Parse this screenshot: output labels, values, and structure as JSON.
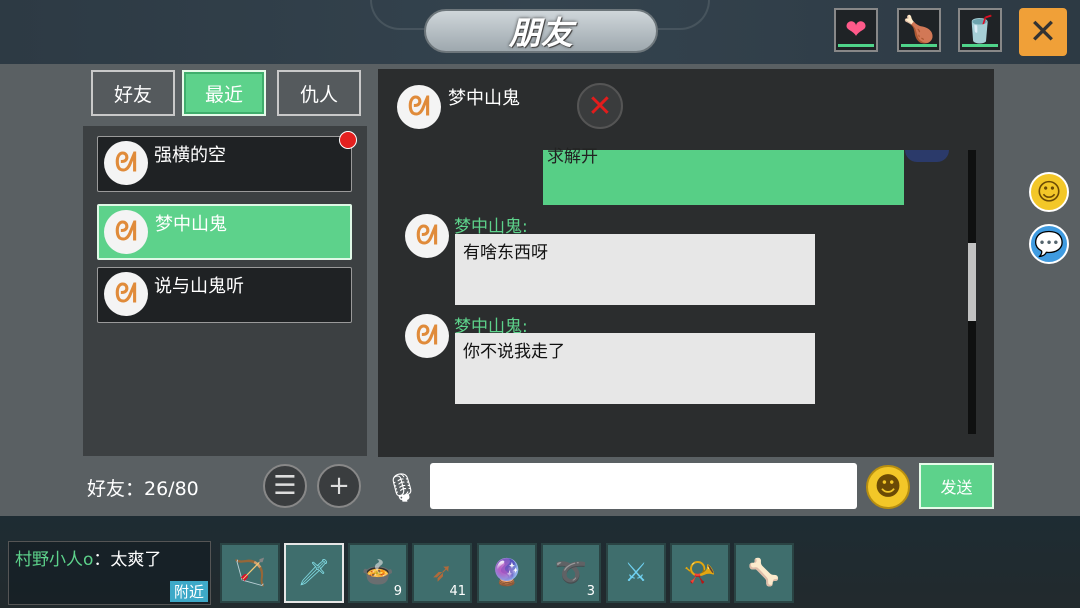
{
  "title": "朋友",
  "title_bg_text": "梦中山鬼",
  "stats": [
    {
      "name": "heart-icon",
      "glyph": "❤",
      "color": "#ff5a8a"
    },
    {
      "name": "food-icon",
      "glyph": "🍗",
      "color": "#ffd23c"
    },
    {
      "name": "water-icon",
      "glyph": "🥤",
      "color": "#3fd1c9"
    }
  ],
  "close_glyph": "✕",
  "tabs": [
    {
      "label": "好友",
      "active": false
    },
    {
      "label": "最近",
      "active": true
    },
    {
      "label": "仇人",
      "active": false
    }
  ],
  "friends": [
    {
      "name": "强横的空",
      "active": false,
      "unread": true
    },
    {
      "name": "梦中山鬼",
      "active": true,
      "unread": false
    },
    {
      "name": "说与山鬼听",
      "active": false,
      "unread": false
    }
  ],
  "friend_count_label": "好友：26/80",
  "chat": {
    "with": "梦中山鬼",
    "partial_text": "求解开",
    "messages": [
      {
        "sender": "梦中山鬼:",
        "text": "有啥东西呀"
      },
      {
        "sender": "梦中山鬼:",
        "text": "你不说我走了"
      }
    ]
  },
  "input": {
    "placeholder": "",
    "send_label": "发送"
  },
  "nearby": {
    "who": "村野小人o",
    "text": "：太爽了",
    "tag": "附近"
  },
  "hotbar": [
    {
      "name": "bow-item",
      "glyph": "🏹",
      "count": ""
    },
    {
      "name": "spear-item",
      "glyph": "🗡",
      "count": ""
    },
    {
      "name": "stew-item",
      "glyph": "🍲",
      "count": "9"
    },
    {
      "name": "arrow-item",
      "glyph": "➶",
      "count": "41"
    },
    {
      "name": "orb-item",
      "glyph": "🔮",
      "count": ""
    },
    {
      "name": "rope-item",
      "glyph": "➰",
      "count": "3"
    },
    {
      "name": "crystal-sword-item",
      "glyph": "⚔",
      "count": ""
    },
    {
      "name": "horn-item",
      "glyph": "📯",
      "count": ""
    },
    {
      "name": "club-item",
      "glyph": "🦴",
      "count": ""
    }
  ]
}
